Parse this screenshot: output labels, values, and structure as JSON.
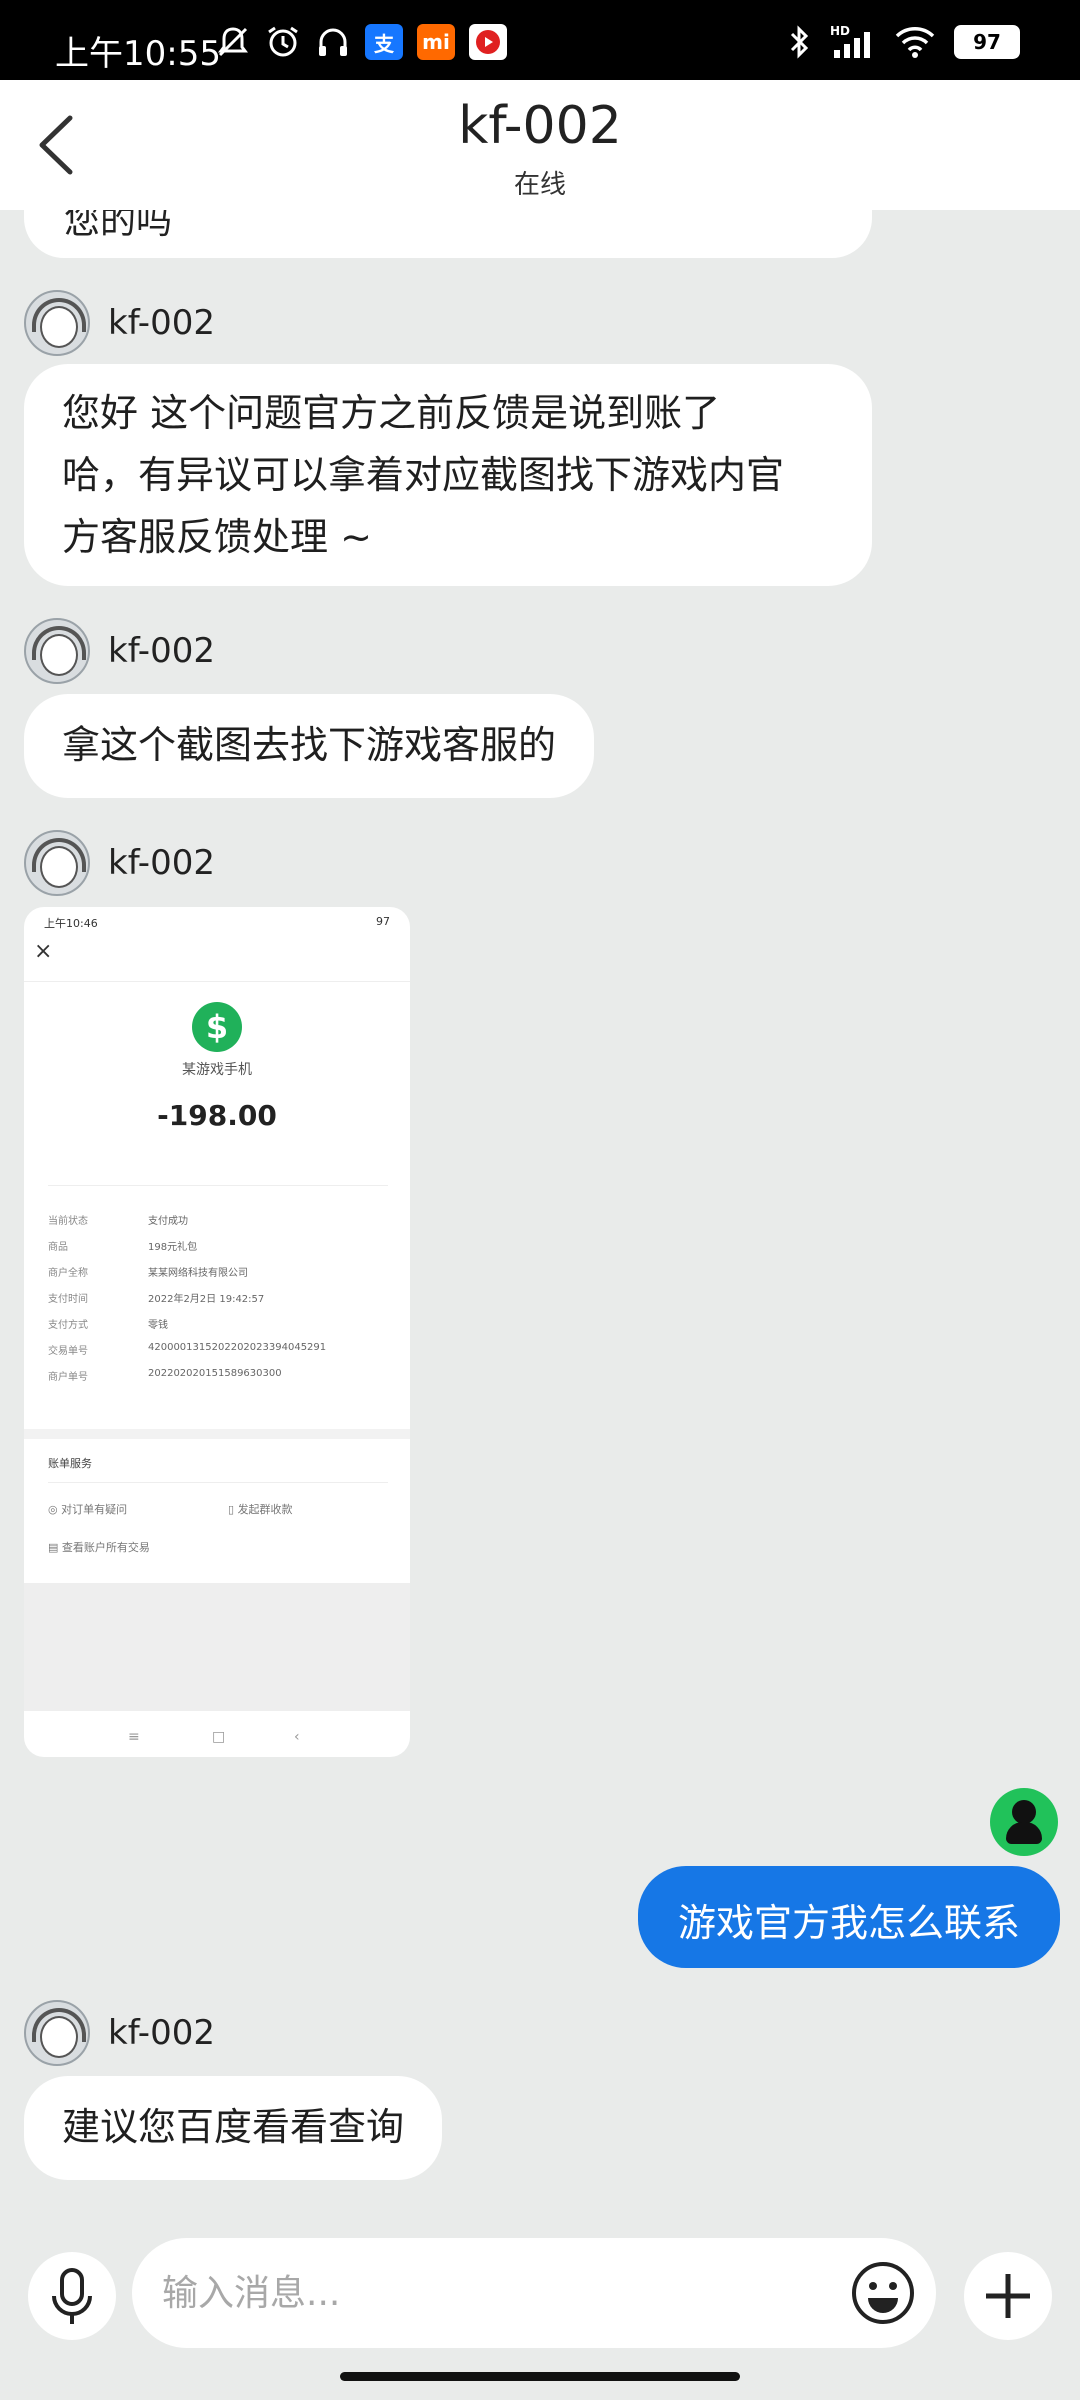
{
  "status_bar": {
    "time": "上午10:55",
    "icons": [
      "mute-bell-icon",
      "alarm-icon",
      "headphones-icon",
      "alipay-icon",
      "mi-icon",
      "video-app-icon"
    ],
    "right_icons": [
      "bluetooth-icon",
      "hd-signal-icon",
      "wifi-icon"
    ],
    "network_tag": "HD",
    "battery": "97"
  },
  "header": {
    "title": "kf-002",
    "subtitle": "在线"
  },
  "messages": {
    "cut_text": "您的吗",
    "m1": {
      "sender": "kf-002",
      "lines": [
        "您好 这个问题官方之前反馈是说到账了",
        "哈，有异议可以拿着对应截图找下游戏内官",
        "方客服反馈处理 ~"
      ]
    },
    "m2": {
      "sender": "kf-002",
      "text": "拿这个截图去找下游戏客服的"
    },
    "m3": {
      "sender": "kf-002",
      "receipt": {
        "status_time": "上午10:46",
        "status_right": "97",
        "close": "×",
        "merchant": "某游戏手机",
        "amount": "-198.00",
        "rows": [
          {
            "k": "当前状态",
            "v": "支付成功"
          },
          {
            "k": "商品",
            "v": "198元礼包"
          },
          {
            "k": "商户全称",
            "v": "某某网络科技有限公司"
          },
          {
            "k": "支付时间",
            "v": "2022年2月2日 19:42:57"
          },
          {
            "k": "支付方式",
            "v": "零钱"
          },
          {
            "k": "交易单号",
            "v": "4200001315202202023394045291"
          },
          {
            "k": "商户单号",
            "v": "202202020151589630300"
          }
        ],
        "section": "账单服务",
        "options": [
          "对订单有疑问",
          "发起群收款",
          "查看账户所有交易"
        ],
        "nav": [
          "≡",
          "□",
          "‹"
        ]
      }
    },
    "m4": {
      "text": "游戏官方我怎么联系"
    },
    "m5": {
      "sender": "kf-002",
      "text": "建议您百度看看查询"
    }
  },
  "input": {
    "placeholder": "输入消息..."
  },
  "colors": {
    "accent": "#1677e6",
    "background": "#e9ebea",
    "my_avatar": "#21c25a",
    "pay_green": "#20b15a"
  }
}
